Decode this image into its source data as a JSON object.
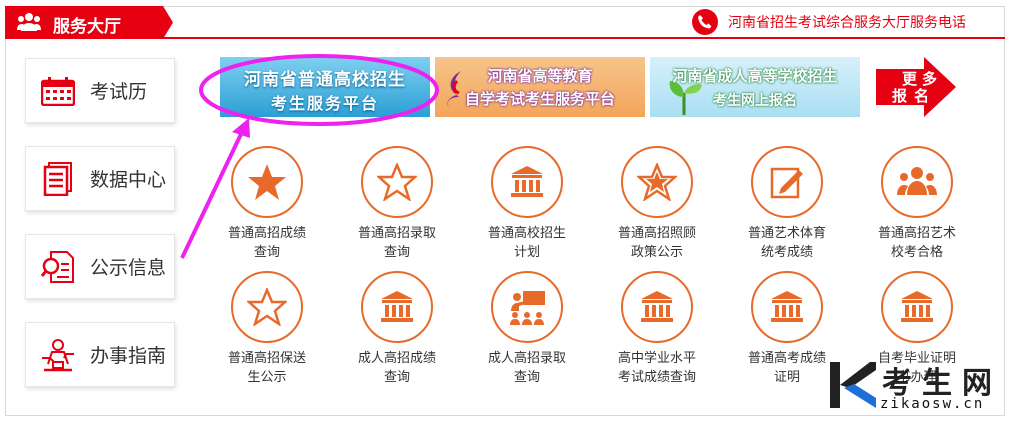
{
  "header": {
    "title": "服务大厅",
    "hotline": "河南省招生考试综合服务大厅服务电话"
  },
  "sidebar": {
    "items": [
      {
        "label": "考试历",
        "icon": "calendar-icon"
      },
      {
        "label": "数据中心",
        "icon": "document-icon"
      },
      {
        "label": "公示信息",
        "icon": "search-doc-icon"
      },
      {
        "label": "办事指南",
        "icon": "guide-person-icon"
      }
    ]
  },
  "banners": [
    {
      "line1": "河南省普通高校招生",
      "line2": "考生服务平台"
    },
    {
      "line1": "河南省高等教育",
      "line2": "自学考试考生服务平台"
    },
    {
      "line1": "河南省成人高等学校招生",
      "line2": "考生网上报名"
    }
  ],
  "more": {
    "text1": "更",
    "text2": "多",
    "text3": "报",
    "text4": "名"
  },
  "services": [
    {
      "line1": "普通高招成绩",
      "line2": "查询",
      "icon": "star-filled-icon"
    },
    {
      "line1": "普通高招录取",
      "line2": "查询",
      "icon": "star-outline-icon"
    },
    {
      "line1": "普通高校招生",
      "line2": "计划",
      "icon": "building-icon"
    },
    {
      "line1": "普通高招照顾",
      "line2": "政策公示",
      "icon": "star-outline-icon"
    },
    {
      "line1": "普通艺术体育",
      "line2": "统考成绩",
      "icon": "edit-note-icon"
    },
    {
      "line1": "普通高招艺术",
      "line2": "校考合格",
      "icon": "group-icon"
    },
    {
      "line1": "普通高招保送",
      "line2": "生公示",
      "icon": "star-outline-icon"
    },
    {
      "line1": "成人高招成绩",
      "line2": "查询",
      "icon": "building-icon"
    },
    {
      "line1": "成人高招录取",
      "line2": "查询",
      "icon": "presenter-icon"
    },
    {
      "line1": "高中学业水平",
      "line2": "考试成绩查询",
      "icon": "building-icon"
    },
    {
      "line1": "普通高考成绩",
      "line2": "证明",
      "icon": "building-icon"
    },
    {
      "line1": "自考毕业证明",
      "line2": "书办理",
      "icon": "building-icon"
    }
  ],
  "watermark": {
    "brand": "考生网",
    "domain": "zikaosw.cn"
  },
  "colors": {
    "accent": "#e60012",
    "icon": "#e86a2b",
    "highlight": "#ee22ee"
  }
}
